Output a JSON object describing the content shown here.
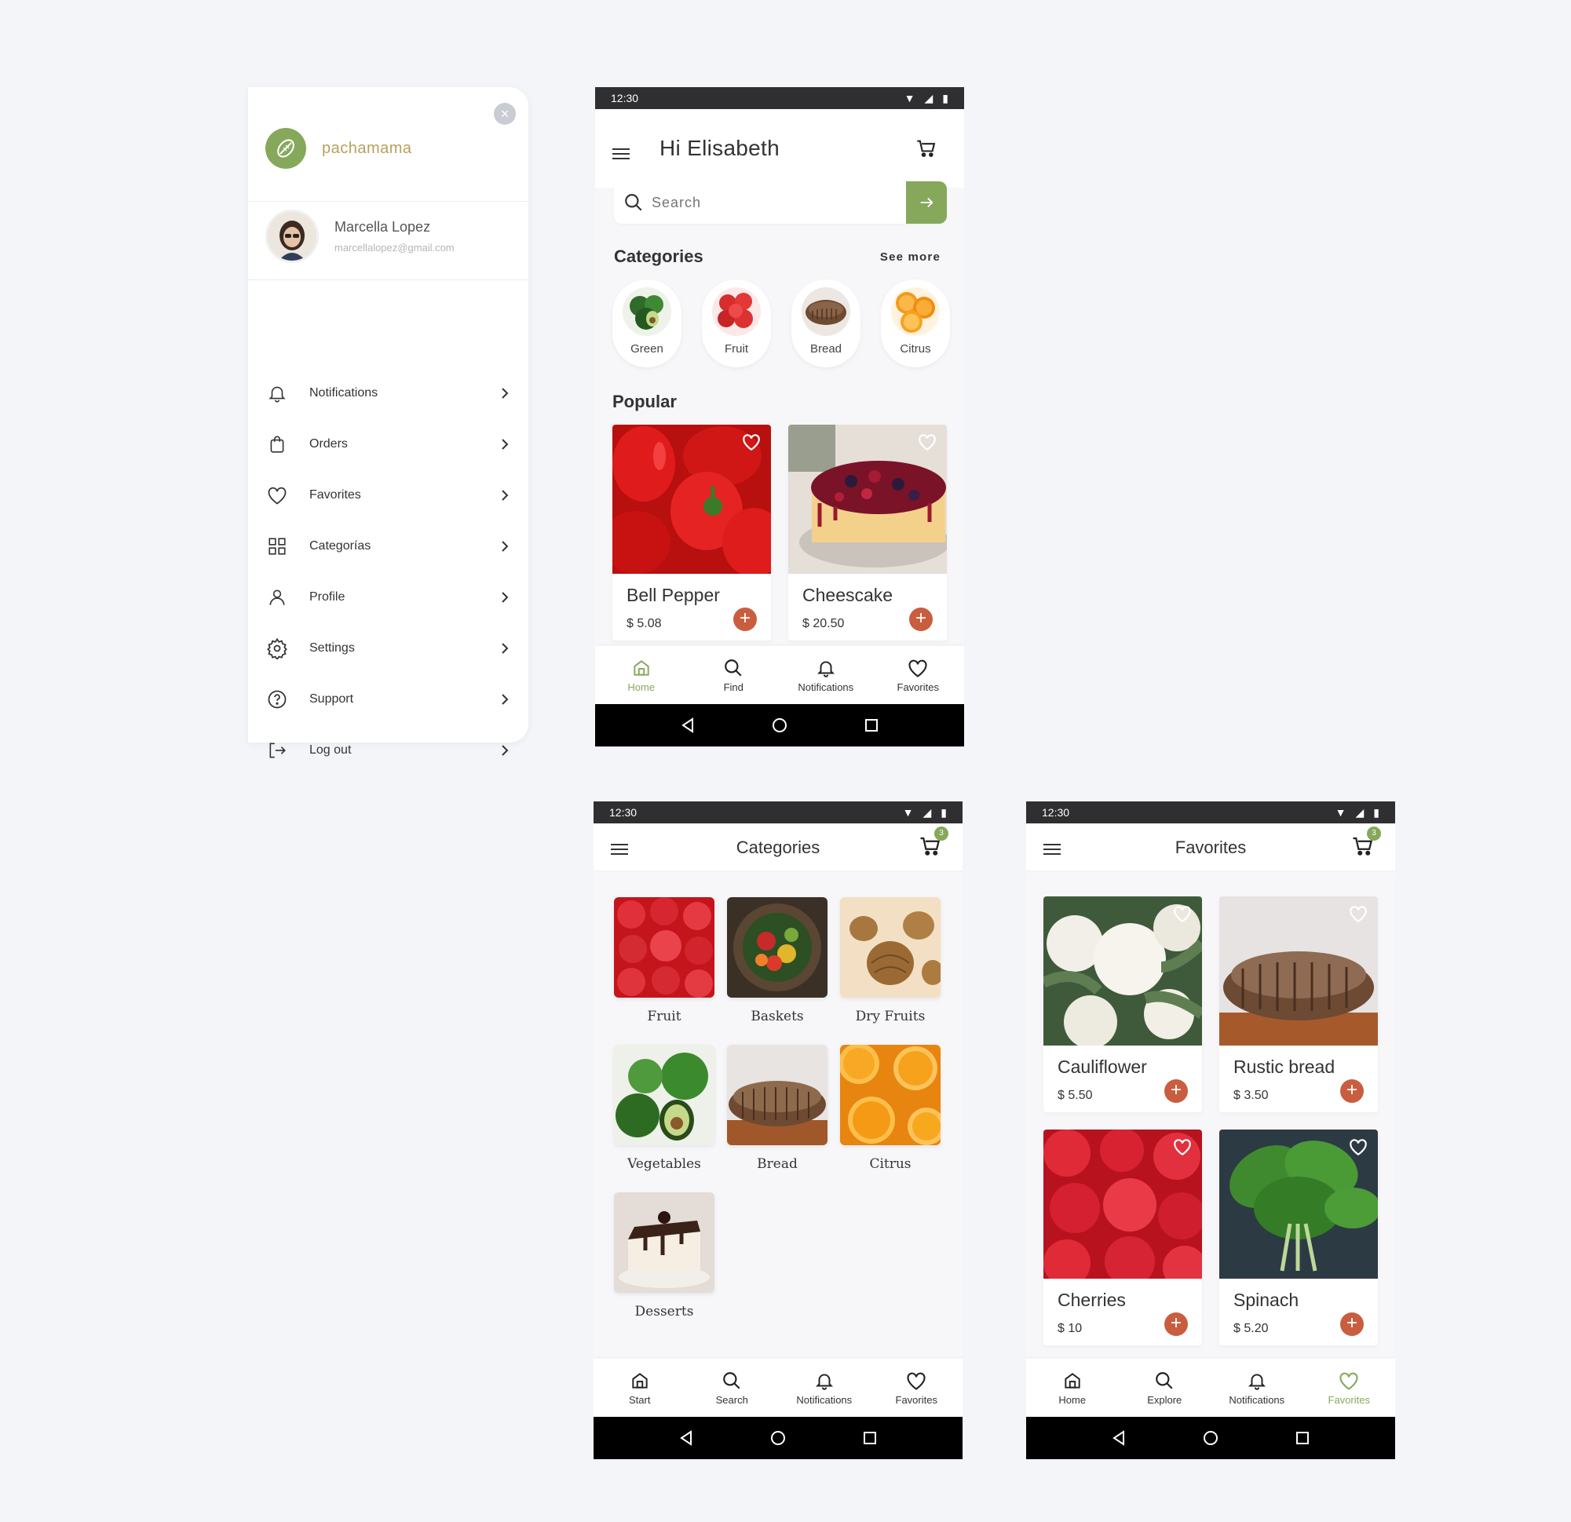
{
  "drawer": {
    "brand": "pachamama",
    "user": {
      "name": "Marcella Lopez",
      "email": "marcellalopez@gmail.com"
    },
    "items": [
      {
        "label": "Notifications",
        "icon": "bell-icon"
      },
      {
        "label": "Orders",
        "icon": "bag-icon"
      },
      {
        "label": "Favorites",
        "icon": "heart-icon"
      },
      {
        "label": "Categorías",
        "icon": "grid-icon"
      },
      {
        "label": "Profile",
        "icon": "user-icon"
      },
      {
        "label": "Settings",
        "icon": "gear-icon"
      },
      {
        "label": "Support",
        "icon": "help-icon"
      },
      {
        "label": "Log out",
        "icon": "logout-icon"
      }
    ]
  },
  "home": {
    "time": "12:30",
    "greeting": "Hi Elisabeth",
    "search_placeholder": "Search",
    "categories_title": "Categories",
    "see_more": "See more",
    "categories": [
      "Green",
      "Fruit",
      "Bread",
      "Citrus"
    ],
    "popular_title": "Popular",
    "popular": [
      {
        "name": "Bell Pepper",
        "price": "$ 5.08"
      },
      {
        "name": "Cheescake",
        "price": "$ 20.50"
      }
    ],
    "tabs": [
      "Home",
      "Find",
      "Notifications",
      "Favorites"
    ]
  },
  "categories_screen": {
    "time": "12:30",
    "title": "Categories",
    "cart_badge": "3",
    "tiles": [
      "Fruit",
      "Baskets",
      "Dry Fruits",
      "Vegetables",
      "Bread",
      "Citrus",
      "Desserts"
    ],
    "tabs": [
      "Start",
      "Search",
      "Notifications",
      "Favorites"
    ]
  },
  "favorites_screen": {
    "time": "12:30",
    "title": "Favorites",
    "cart_badge": "3",
    "items": [
      {
        "name": "Cauliflower",
        "price": "$ 5.50"
      },
      {
        "name": "Rustic bread",
        "price": "$ 3.50"
      },
      {
        "name": "Cherries",
        "price": "$ 10"
      },
      {
        "name": "Spinach",
        "price": "$ 5.20"
      }
    ],
    "tabs": [
      "Home",
      "Explore",
      "Notifications",
      "Favorites"
    ]
  },
  "colors": {
    "accent": "#86a85b",
    "add_button": "#c85e3f",
    "brand_text": "#b8a05c"
  }
}
